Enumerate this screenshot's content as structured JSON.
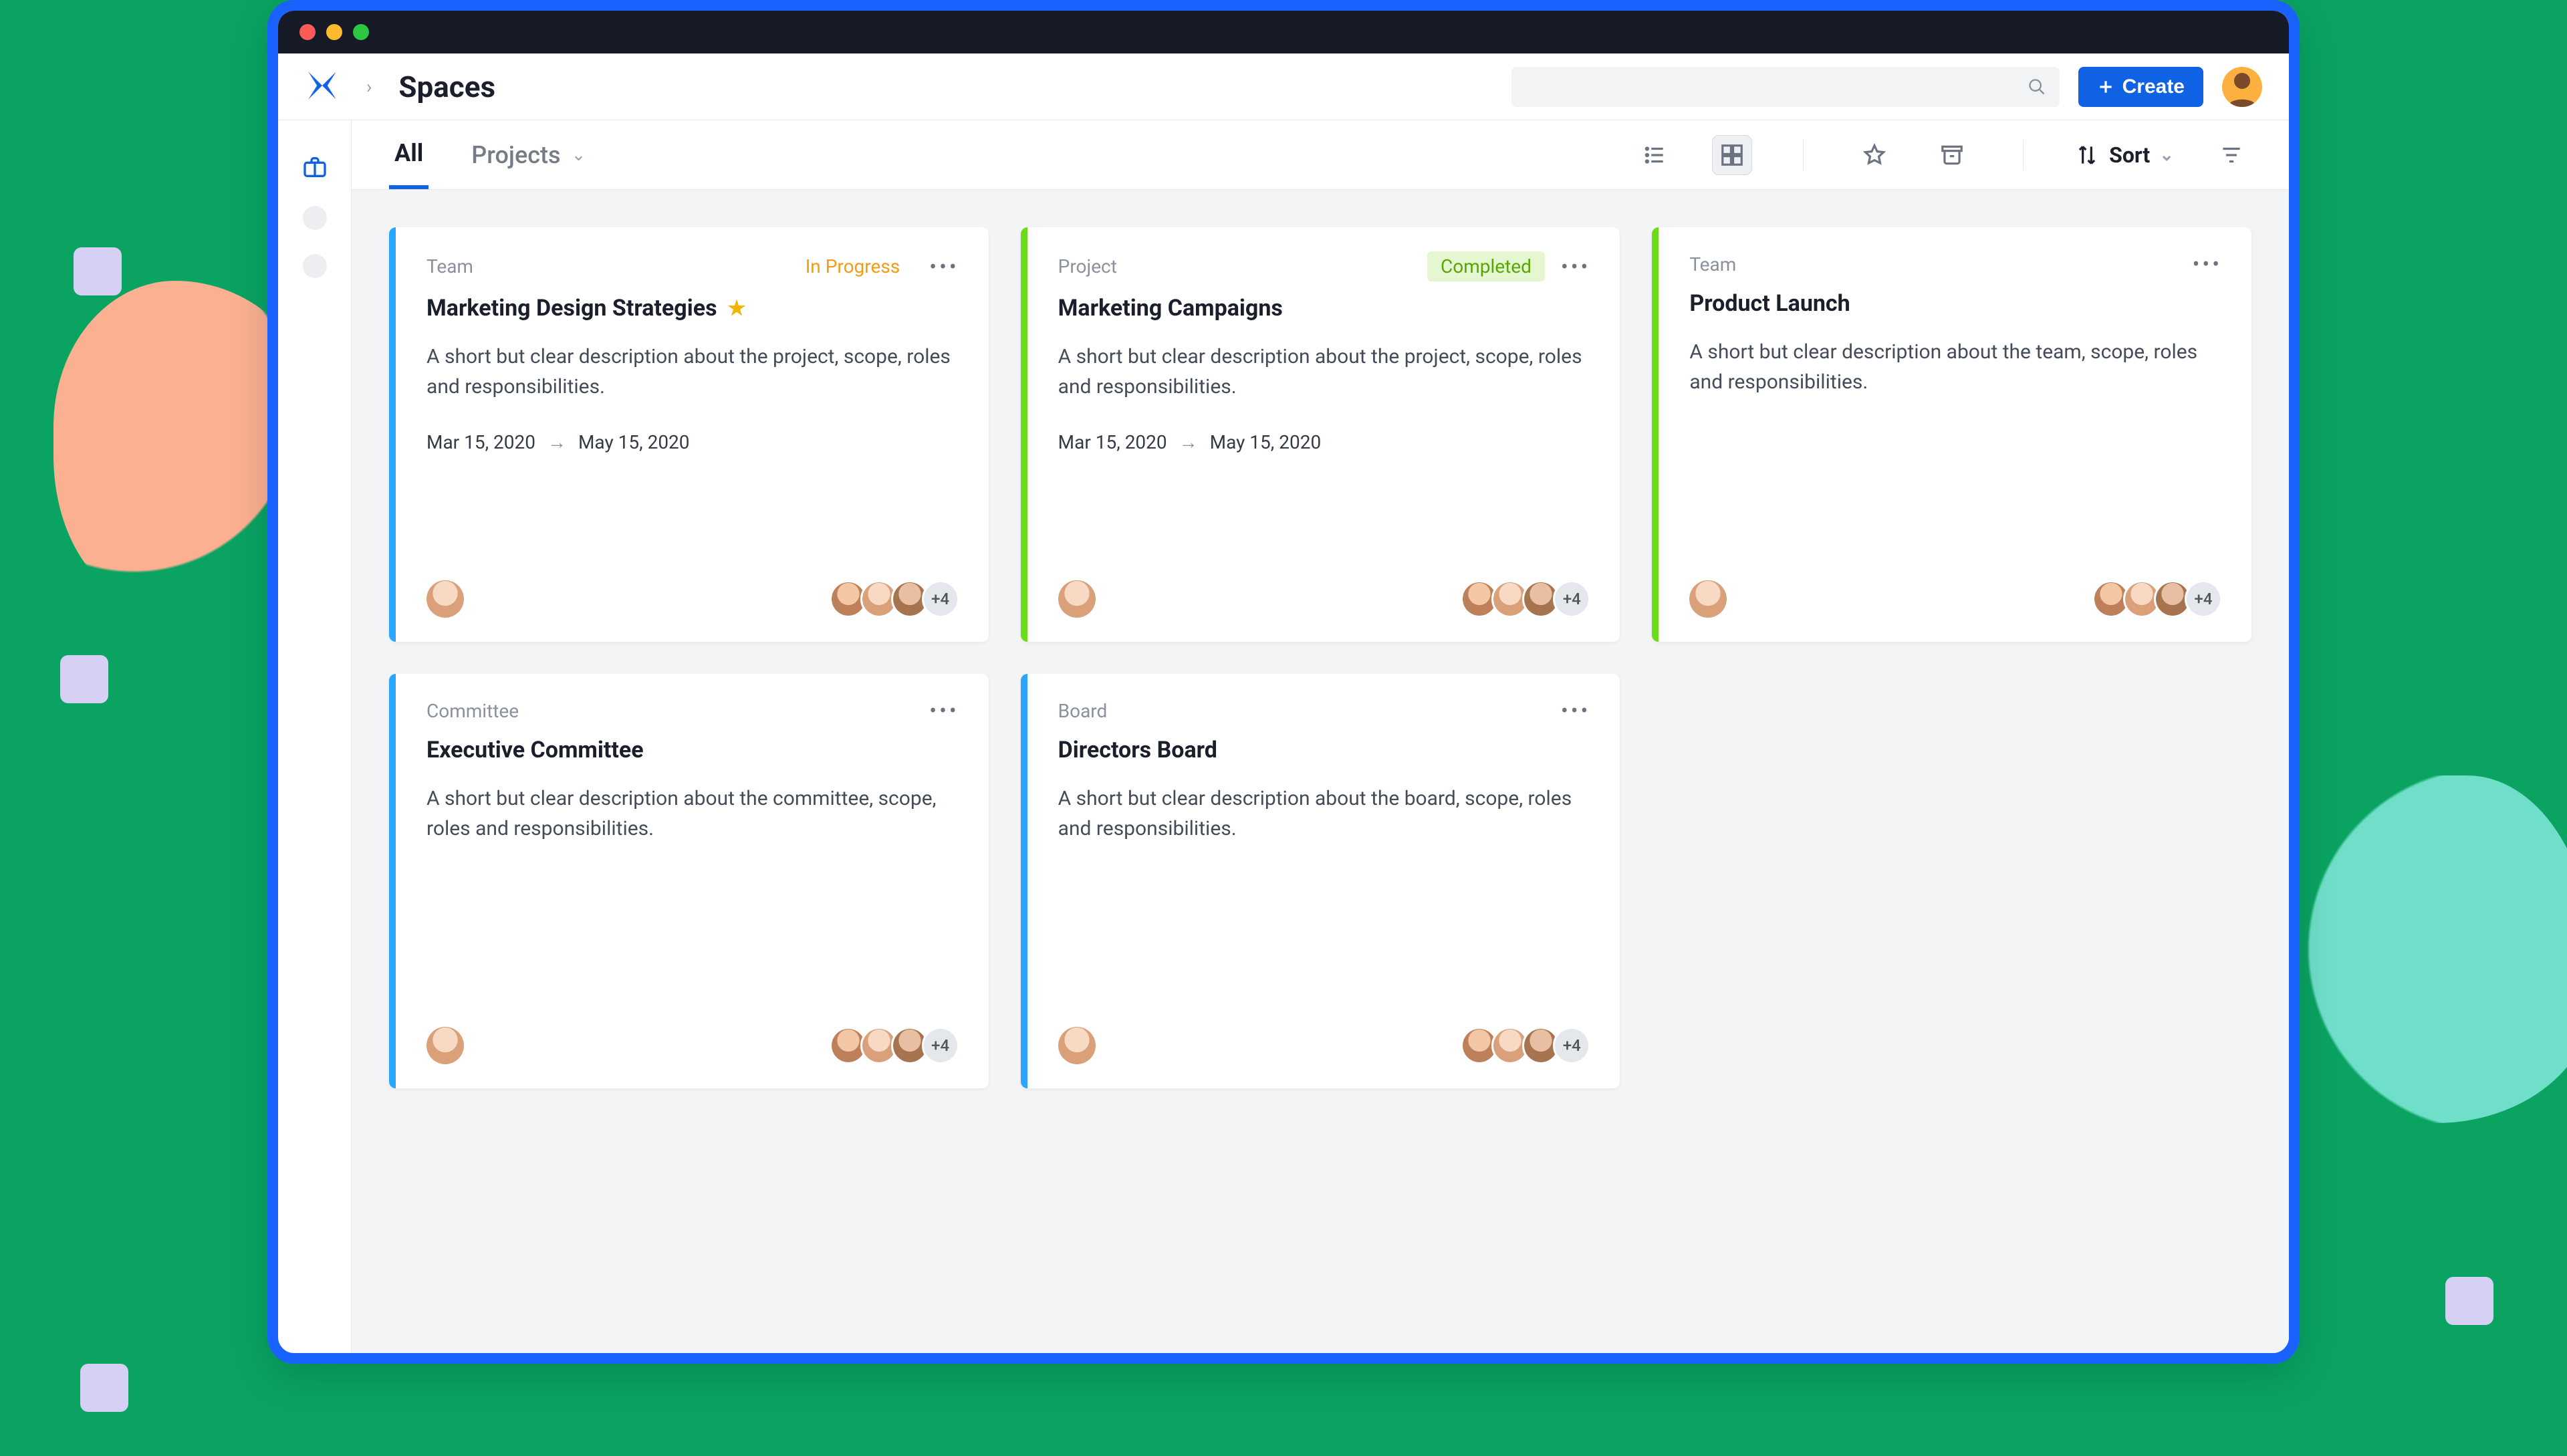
{
  "header": {
    "title": "Spaces",
    "create_label": "Create",
    "search_placeholder": ""
  },
  "tabs": {
    "all": "All",
    "projects": "Projects"
  },
  "toolbar": {
    "sort_label": "Sort"
  },
  "cards": [
    {
      "category": "Team",
      "status": "In Progress",
      "status_kind": "progress",
      "title": "Marketing Design Strategies",
      "starred": true,
      "desc": "A short but clear description about the project, scope, roles and responsibilities.",
      "start_date": "Mar 15, 2020",
      "end_date": "May 15, 2020",
      "extra_count": "+4",
      "accent": "blue"
    },
    {
      "category": "Project",
      "status": "Completed",
      "status_kind": "completed",
      "title": "Marketing Campaigns",
      "starred": false,
      "desc": "A short but clear description about the project, scope, roles and responsibilities.",
      "start_date": "Mar 15, 2020",
      "end_date": "May 15, 2020",
      "extra_count": "+4",
      "accent": "green"
    },
    {
      "category": "Team",
      "status": "",
      "status_kind": "",
      "title": "Product Launch",
      "starred": false,
      "desc": "A short but clear description about the team, scope, roles and responsibilities.",
      "start_date": "",
      "end_date": "",
      "extra_count": "+4",
      "accent": "green"
    },
    {
      "category": "Committee",
      "status": "",
      "status_kind": "",
      "title": "Executive Committee",
      "starred": false,
      "desc": "A short but clear description about the committee, scope, roles and responsibilities.",
      "start_date": "",
      "end_date": "",
      "extra_count": "+4",
      "accent": "blue"
    },
    {
      "category": "Board",
      "status": "",
      "status_kind": "",
      "title": "Directors Board",
      "starred": false,
      "desc": "A short but clear description about the board, scope, roles and responsibilities.",
      "start_date": "",
      "end_date": "",
      "extra_count": "+4",
      "accent": "blue"
    }
  ]
}
